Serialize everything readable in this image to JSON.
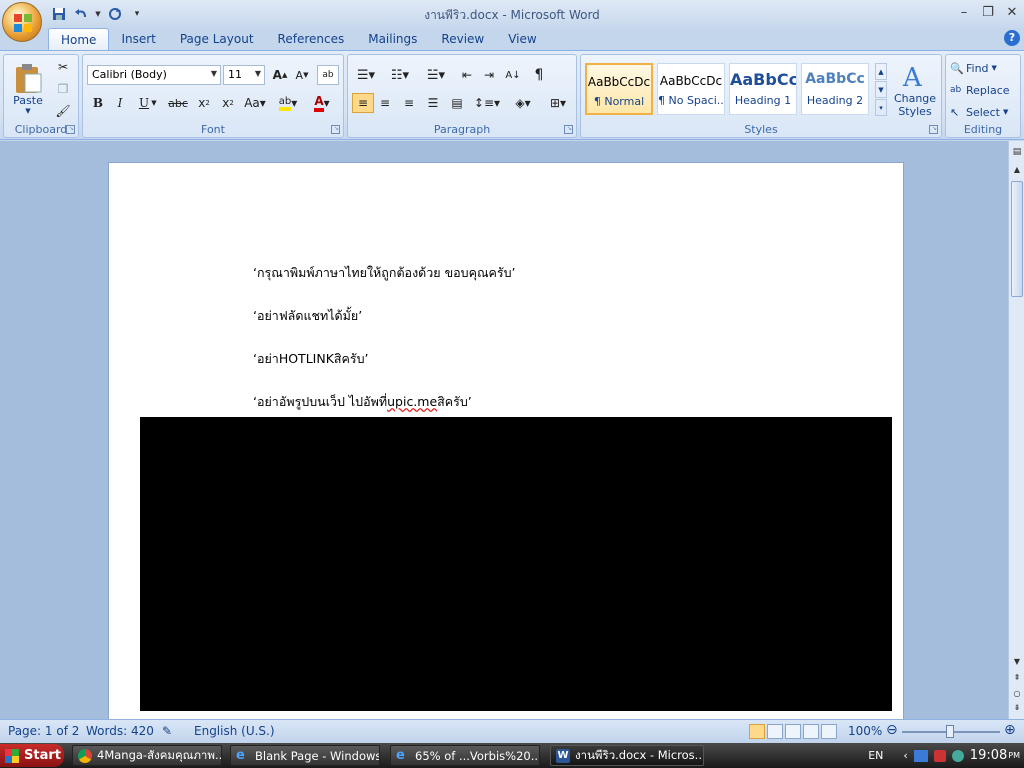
{
  "window": {
    "title": "งานพีริว.docx - Microsoft Word",
    "controls": {
      "minimize": "–",
      "restore": "❐",
      "close": "✕"
    }
  },
  "tabs": [
    "Home",
    "Insert",
    "Page Layout",
    "References",
    "Mailings",
    "Review",
    "View"
  ],
  "ribbon": {
    "clipboard": {
      "label": "Clipboard",
      "paste": "Paste"
    },
    "font": {
      "label": "Font",
      "font_name": "Calibri (Body)",
      "font_size": "11"
    },
    "paragraph": {
      "label": "Paragraph"
    },
    "styles": {
      "label": "Styles",
      "items": [
        {
          "sample": "AaBbCcDc",
          "name": "¶ Normal"
        },
        {
          "sample": "AaBbCcDc",
          "name": "¶ No Spaci..."
        },
        {
          "sample": "AaBbCc",
          "name": "Heading 1"
        },
        {
          "sample": "AaBbCc",
          "name": "Heading 2"
        }
      ],
      "change_styles": "Change Styles"
    },
    "editing": {
      "label": "Editing",
      "find": "Find",
      "replace": "Replace",
      "select": "Select"
    }
  },
  "document": {
    "paragraphs": [
      "‘กรุณาพิมพ์ภาษาไทยให้ถูกต้องด้วย ขอบคุณครับ’",
      "‘อย่าฟลัดแชทได้มั้ย’",
      "‘อย่าHOTLINKสิครับ’"
    ],
    "p4_prefix": "‘อย่าอัพรูปบนเว็ป ไปอัพที่",
    "p4_link": "upic.me",
    "p4_suffix": "สิครับ’"
  },
  "status": {
    "page": "Page: 1 of 2",
    "words": "Words: 420",
    "language": "English (U.S.)",
    "zoom": "100%"
  },
  "taskbar": {
    "start": "Start",
    "tasks": [
      "4Manga-สังคมคุณภาพ...",
      "Blank Page - Windows...",
      "65% of ...Vorbis%20...",
      "งานพีริว.docx - Micros..."
    ],
    "lang": "EN",
    "time": "19:08",
    "ampm": "PM"
  }
}
